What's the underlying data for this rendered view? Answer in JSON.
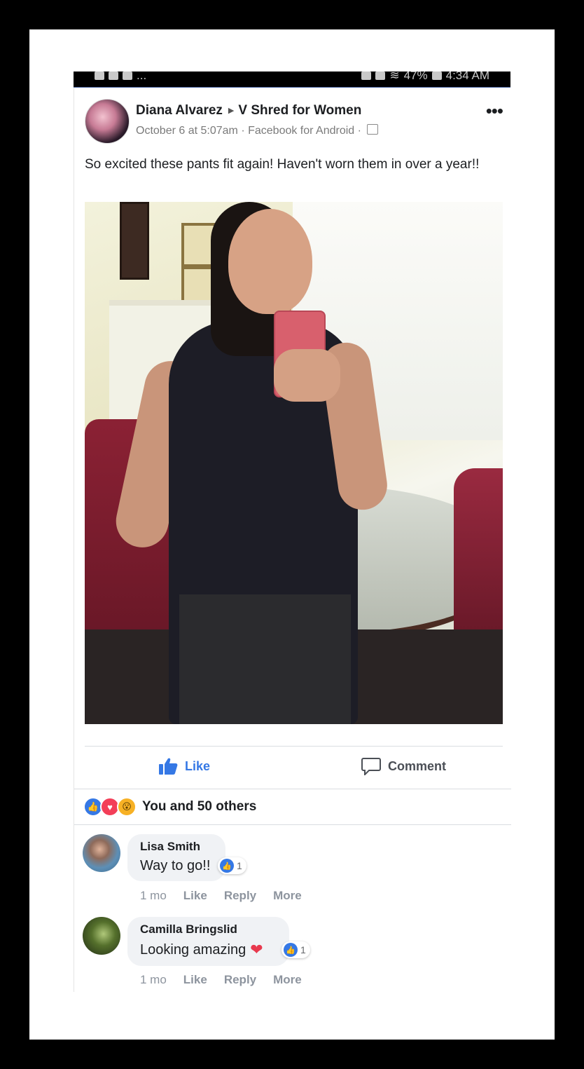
{
  "status_bar": {
    "left_extra": "...",
    "battery": "47%",
    "time": "4:34 AM"
  },
  "post": {
    "author": "Diana Alvarez",
    "group": "V Shred for Women",
    "date": "October 6 at 5:07am",
    "source": "Facebook for Android",
    "separator": "·",
    "text": "So excited these pants fit again! Haven't worn them in over a year!!",
    "more_icon_label": "•••"
  },
  "actions": {
    "like": "Like",
    "comment": "Comment"
  },
  "reactions": {
    "summary": "You and 50 others",
    "icons": [
      "like-icon",
      "love-icon",
      "wow-icon"
    ]
  },
  "comments": [
    {
      "name": "Lisa Smith",
      "text": "Way to go!!",
      "reaction_count": "1",
      "time": "1 mo",
      "like": "Like",
      "reply": "Reply",
      "more": "More"
    },
    {
      "name": "Camilla Bringslid",
      "text": "Looking amazing",
      "emoji": "❤",
      "reaction_count": "1",
      "time": "1 mo",
      "like": "Like",
      "reply": "Reply",
      "more": "More"
    }
  ],
  "colors": {
    "accent": "#3578e5",
    "love": "#f33e58",
    "wow": "#f7b125"
  }
}
